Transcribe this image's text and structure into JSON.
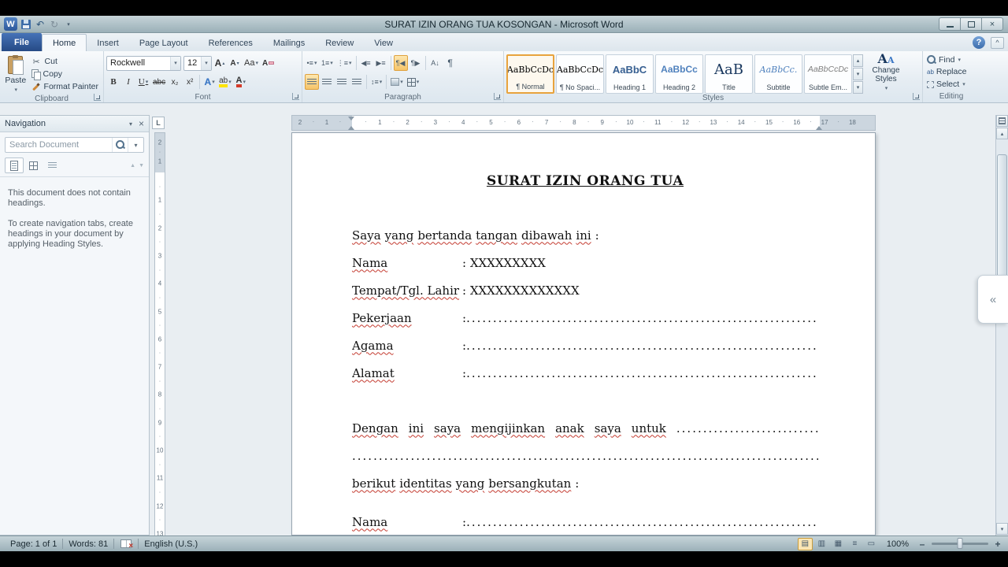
{
  "window": {
    "title": "SURAT IZIN ORANG TUA KOSONGAN  -  Microsoft Word"
  },
  "icons": {
    "w_logo": "W",
    "undo": "↶",
    "repeat": "↻",
    "close": "×",
    "help": "?",
    "collapse_ribbon": "^",
    "collapse_pane": "«",
    "bold": "B",
    "italic": "I",
    "underline": "U",
    "strikethrough": "abc",
    "subscript": "x₂",
    "superscript": "x²",
    "grow_font": "A",
    "shrink_font": "A",
    "change_case": "Aa",
    "clear_formatting": "A",
    "text_effects": "A",
    "highlight": "ab",
    "font_color": "A",
    "paragraph_mark": "¶"
  },
  "ribbon_tabs": [
    {
      "label": "File",
      "type": "file"
    },
    {
      "label": "Home",
      "active": true
    },
    {
      "label": "Insert"
    },
    {
      "label": "Page Layout"
    },
    {
      "label": "References"
    },
    {
      "label": "Mailings"
    },
    {
      "label": "Review"
    },
    {
      "label": "View"
    }
  ],
  "ribbon": {
    "clipboard": {
      "title": "Clipboard",
      "paste": "Paste",
      "cut": "Cut",
      "copy": "Copy",
      "format_painter": "Format Painter"
    },
    "font": {
      "title": "Font",
      "family": "Rockwell",
      "size": "12"
    },
    "paragraph": {
      "title": "Paragraph"
    },
    "styles": {
      "title": "Styles",
      "items": [
        {
          "preview": "AaBbCcDc",
          "label": "¶ Normal",
          "style": "normal",
          "selected": true
        },
        {
          "preview": "AaBbCcDc",
          "label": "¶ No Spaci...",
          "style": "normal"
        },
        {
          "preview": "AaBbC",
          "label": "Heading 1",
          "style": "h1"
        },
        {
          "preview": "AaBbCc",
          "label": "Heading 2",
          "style": "h2"
        },
        {
          "preview": "AaB",
          "label": "Title",
          "style": "title"
        },
        {
          "preview": "AaBbCc.",
          "label": "Subtitle",
          "style": "subtitle"
        },
        {
          "preview": "AaBbCcDc",
          "label": "Subtle Em...",
          "style": "subtle"
        }
      ]
    },
    "change_styles": {
      "label": "Change Styles"
    },
    "editing": {
      "title": "Editing",
      "find": "Find",
      "replace": "Replace",
      "select": "Select"
    }
  },
  "navigation": {
    "title": "Navigation",
    "search_placeholder": "Search Document",
    "empty_line1": "This document does not contain headings.",
    "empty_line2": "To create navigation tabs, create headings in your document by applying Heading Styles."
  },
  "ruler": {
    "h_margin_numbers": [
      "2",
      "1"
    ],
    "h_numbers": [
      "1",
      "2",
      "3",
      "4",
      "5",
      "6",
      "7",
      "8",
      "9",
      "10",
      "11",
      "12",
      "13",
      "14",
      "15",
      "16",
      "17",
      "18"
    ],
    "v_margin_numbers": [
      "2",
      "1"
    ],
    "v_numbers": [
      "1",
      "2",
      "3",
      "4",
      "5",
      "6",
      "7",
      "8",
      "9",
      "10",
      "11",
      "12",
      "13"
    ]
  },
  "document": {
    "title": "SURAT IZIN ORANG TUA",
    "dots": "........................................................................................................................................................",
    "lines": [
      {
        "type": "words",
        "segs": [
          [
            "Saya",
            1
          ],
          [
            "yang",
            1
          ],
          [
            "bertanda",
            1
          ],
          [
            "tangan",
            1
          ],
          [
            "dibawah",
            1
          ],
          [
            "ini",
            1
          ],
          [
            ":",
            0
          ]
        ]
      },
      {
        "type": "field",
        "label": "Nama",
        "value": ": XXXXXXXXX"
      },
      {
        "type": "field",
        "label": "Tempat/Tgl. Lahir",
        "value": ": XXXXXXXXXXXXX"
      },
      {
        "type": "field_dots",
        "label": "Pekerjaan"
      },
      {
        "type": "field_dots",
        "label": "Agama"
      },
      {
        "type": "field_dots",
        "label": "Alamat"
      },
      {
        "type": "blank"
      },
      {
        "type": "words_dots",
        "wide": true,
        "segs": [
          [
            "Dengan",
            1
          ],
          [
            "ini",
            1
          ],
          [
            "saya",
            1
          ],
          [
            "mengijinkan",
            1
          ],
          [
            "anak",
            1
          ],
          [
            "saya",
            1
          ],
          [
            "untuk",
            1
          ]
        ]
      },
      {
        "type": "dots_line"
      },
      {
        "type": "words",
        "segs": [
          [
            "berikut",
            1
          ],
          [
            "identitas",
            1
          ],
          [
            "yang",
            1
          ],
          [
            "bersangkutan",
            1
          ],
          [
            ":",
            0
          ]
        ]
      },
      {
        "type": "blank_half"
      },
      {
        "type": "field_dots",
        "label": "Nama"
      }
    ]
  },
  "status": {
    "page": "Page: 1 of 1",
    "words": "Words: 81",
    "language": "English (U.S.)",
    "zoom": "100%"
  }
}
